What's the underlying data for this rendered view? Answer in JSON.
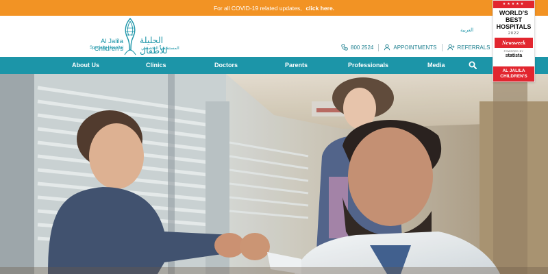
{
  "banner": {
    "text": "For all COVID-19 related updates,",
    "link": "click here."
  },
  "logo": {
    "name_en": "Al Jalila Children's",
    "subtitle_en": "Specialty Hospital",
    "name_ar": "الجليلة للأطفال",
    "subtitle_ar": "المستشفى التخصصي"
  },
  "header": {
    "language_link": "العربية",
    "phone": "800 2524",
    "appointments": "APPOINTMENTS",
    "referrals": "REFERRALS"
  },
  "award": {
    "stars": "★★★★★",
    "title_lines": [
      "WORLD'S",
      "BEST",
      "HOSPITALS"
    ],
    "year": "2022",
    "publisher": "Newsweek",
    "powered_by": "POWERED BY",
    "partner": "statista",
    "hospital_lines": [
      "AL JALILA",
      "CHILDREN'S"
    ]
  },
  "nav": {
    "items": [
      "About Us",
      "Clinics",
      "Doctors",
      "Parents",
      "Professionals",
      "Media"
    ]
  },
  "icons": {
    "phone": "phone-icon",
    "appointments": "user-icon",
    "referrals": "user-plus-icon",
    "search": "search-icon"
  },
  "colors": {
    "banner": "#f29324",
    "brand_teal": "#1c95a8",
    "award_red": "#e2262f"
  }
}
